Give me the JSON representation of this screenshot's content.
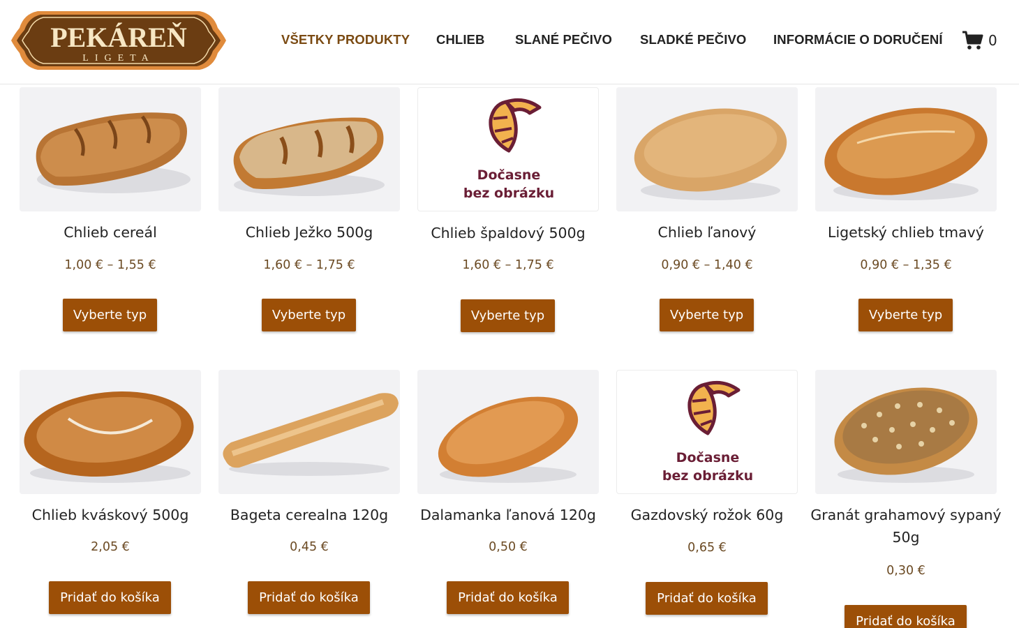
{
  "brand": {
    "name": "PEKÁREŇ",
    "subtitle": "LIGETA"
  },
  "nav": {
    "items": [
      {
        "label": "VŠETKY PRODUKTY",
        "active": true
      },
      {
        "label": "CHLIEB",
        "active": false
      },
      {
        "label": "SLANÉ PEČIVO",
        "active": false
      },
      {
        "label": "SLADKÉ PEČIVO",
        "active": false
      },
      {
        "label": "INFORMÁCIE O DORUČENÍ",
        "active": false
      }
    ]
  },
  "cart": {
    "icon": "cart-icon",
    "count": "0"
  },
  "placeholder": {
    "line1": "Dočasne",
    "line2": "bez obrázku",
    "icon": "croissant-icon"
  },
  "colors": {
    "button": "#9c4f07",
    "price": "#6b4a23",
    "nav_active": "#7a4a12",
    "logo_brown": "#6b3d12",
    "logo_orange": "#e08b3c",
    "placeholder_text": "#6a1e35"
  },
  "products": [
    {
      "title": "Chlieb cereál",
      "price": "1,00 € – 1,55 €",
      "button": "Vyberte typ",
      "image": "photo"
    },
    {
      "title": "Chlieb Ježko 500g",
      "price": "1,60 € – 1,75 €",
      "button": "Vyberte typ",
      "image": "photo"
    },
    {
      "title": "Chlieb špaldový 500g",
      "price": "1,60 € – 1,75 €",
      "button": "Vyberte typ",
      "image": "placeholder"
    },
    {
      "title": "Chlieb ľanový",
      "price": "0,90 € – 1,40 €",
      "button": "Vyberte typ",
      "image": "photo"
    },
    {
      "title": "Ligetský chlieb tmavý",
      "price": "0,90 € – 1,35 €",
      "button": "Vyberte typ",
      "image": "photo"
    },
    {
      "title": "Chlieb kváskový 500g",
      "price": "2,05 €",
      "button": "Pridať do košíka",
      "image": "photo"
    },
    {
      "title": "Bageta cerealna 120g",
      "price": "0,45 €",
      "button": "Pridať do košíka",
      "image": "photo"
    },
    {
      "title": "Dalamanka ľanová 120g",
      "price": "0,50 €",
      "button": "Pridať do košíka",
      "image": "photo"
    },
    {
      "title": "Gazdovský rožok 60g",
      "price": "0,65 €",
      "button": "Pridať do košíka",
      "image": "placeholder"
    },
    {
      "title": "Granát grahamový sypaný",
      "title2": "50g",
      "price": "0,30 €",
      "button": "Pridať do košíka",
      "image": "photo"
    }
  ]
}
